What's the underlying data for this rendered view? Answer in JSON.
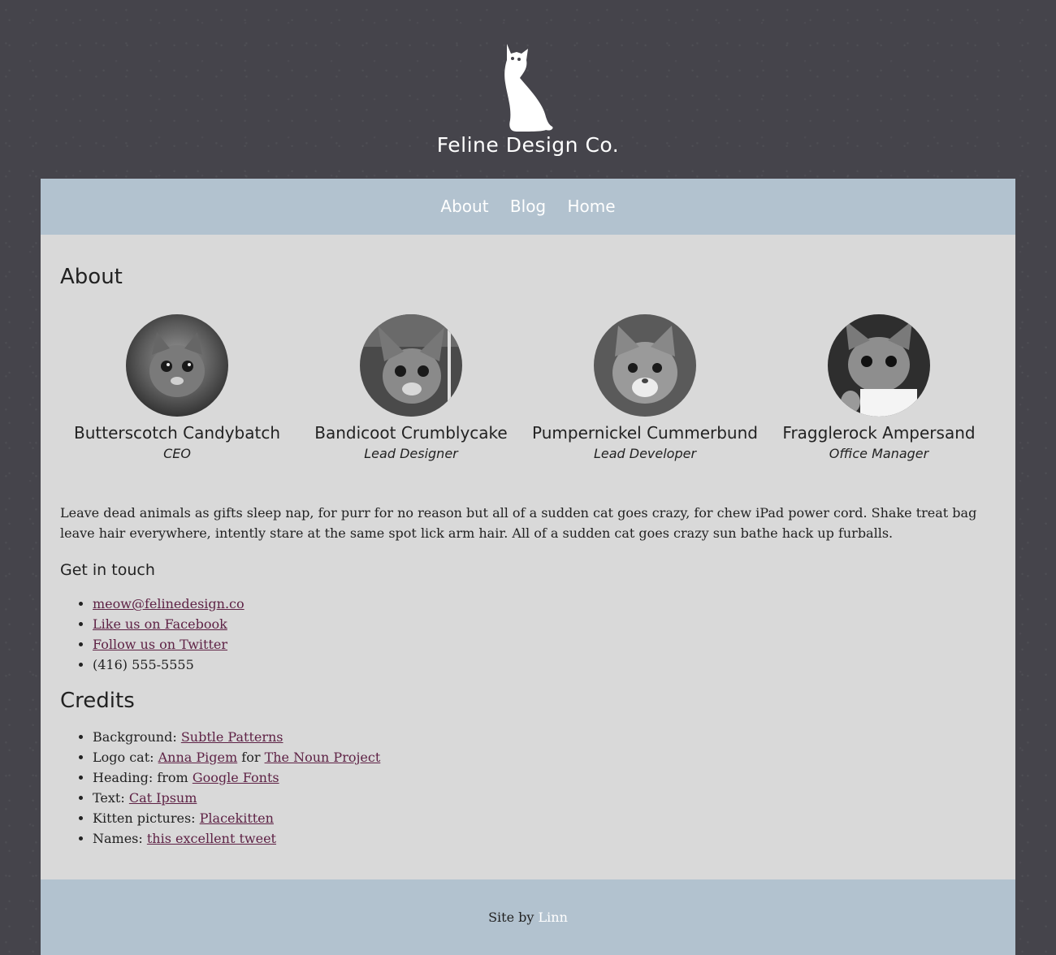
{
  "brand": {
    "name": "Feline Design Co.",
    "logo_icon": "cat-silhouette-icon"
  },
  "nav": {
    "items": [
      {
        "label": "About"
      },
      {
        "label": "Blog"
      },
      {
        "label": "Home"
      }
    ]
  },
  "about": {
    "title": "About",
    "team": [
      {
        "name": "Butterscotch Candybatch",
        "role": "CEO"
      },
      {
        "name": "Bandicoot Crumblycake",
        "role": "Lead Designer"
      },
      {
        "name": "Pumpernickel Cummerbund",
        "role": "Lead Developer"
      },
      {
        "name": "Fragglerock Ampersand",
        "role": "Office Manager"
      }
    ],
    "intro": "Leave dead animals as gifts sleep nap, for purr for no reason but all of a sudden cat goes crazy, for chew iPad power cord. Shake treat bag leave hair everywhere, intently stare at the same spot lick arm hair. All of a sudden cat goes crazy sun bathe hack up furballs."
  },
  "contact": {
    "title": "Get in touch",
    "email": "meow@felinedesign.co",
    "facebook": "Like us on Facebook",
    "twitter": "Follow us on Twitter",
    "phone": "(416) 555-5555"
  },
  "credits": {
    "title": "Credits",
    "items": [
      {
        "prefix": "Background: ",
        "link": "Subtle Patterns"
      },
      {
        "prefix": "Logo cat: ",
        "link": "Anna Pigem",
        "middle": " for ",
        "link2": "The Noun Project"
      },
      {
        "prefix": "Heading: from ",
        "link": "Google Fonts"
      },
      {
        "prefix": "Text: ",
        "link": "Cat Ipsum"
      },
      {
        "prefix": "Kitten pictures: ",
        "link": "Placekitten"
      },
      {
        "prefix": "Names: ",
        "link": "this excellent tweet"
      }
    ]
  },
  "footer": {
    "prefix": "Site by ",
    "link": "Linn"
  },
  "colors": {
    "page_background": "#45444b",
    "content_background": "#d9d9d9",
    "bar_background": "#b2c2cf",
    "link": "#5e2245"
  }
}
